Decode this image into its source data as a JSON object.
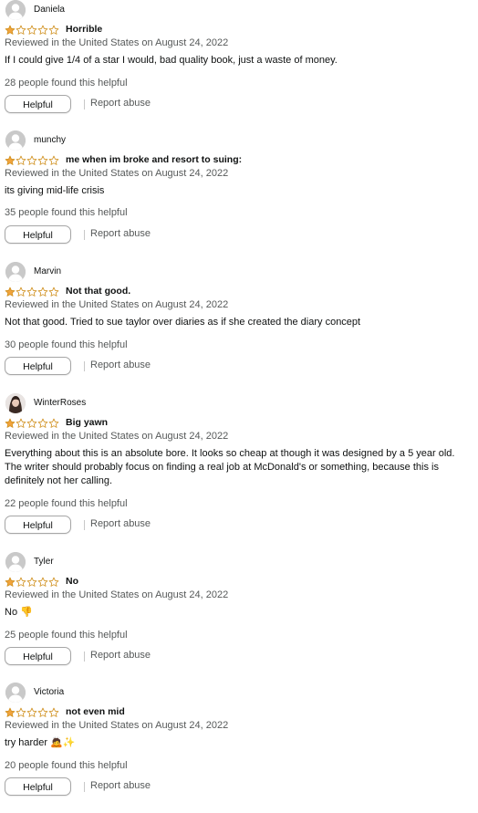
{
  "reviews": [
    {
      "user": "Daniela",
      "avatar": "default",
      "rating": 1,
      "title": "Horrible",
      "meta": "Reviewed in the United States on August 24, 2022",
      "body": "If I could give 1/4 of a star I would, bad quality book, just a waste of money.",
      "helpful_count": "28 people found this helpful",
      "helpful_label": "Helpful",
      "report_label": "Report abuse"
    },
    {
      "user": "munchy",
      "avatar": "default",
      "rating": 1,
      "title": "me when im broke and resort to suing:",
      "meta": "Reviewed in the United States on August 24, 2022",
      "body": "its giving mid-life crisis",
      "helpful_count": "35 people found this helpful",
      "helpful_label": "Helpful",
      "report_label": "Report abuse"
    },
    {
      "user": "Marvin",
      "avatar": "default",
      "rating": 1,
      "title": "Not that good.",
      "meta": "Reviewed in the United States on August 24, 2022",
      "body": "Not that good. Tried to sue taylor over diaries as if she created the diary concept",
      "helpful_count": "30 people found this helpful",
      "helpful_label": "Helpful",
      "report_label": "Report abuse"
    },
    {
      "user": "WinterRoses",
      "avatar": "photo",
      "rating": 1,
      "title": "Big yawn",
      "meta": "Reviewed in the United States on August 24, 2022",
      "body": "Everything about this is an absolute bore. It looks so cheap at though it was designed by a 5 year old. The writer should probably focus on finding a real job at McDonald's or something, because this is definitely not her calling.",
      "helpful_count": "22 people found this helpful",
      "helpful_label": "Helpful",
      "report_label": "Report abuse"
    },
    {
      "user": "Tyler",
      "avatar": "default",
      "rating": 1,
      "title": "No",
      "meta": "Reviewed in the United States on August 24, 2022",
      "body": "No 👎",
      "helpful_count": "25 people found this helpful",
      "helpful_label": "Helpful",
      "report_label": "Report abuse"
    },
    {
      "user": "Victoria",
      "avatar": "default",
      "rating": 1,
      "title": "not even mid",
      "meta": "Reviewed in the United States on August 24, 2022",
      "body": "try harder 🙇✨",
      "helpful_count": "20 people found this helpful",
      "helpful_label": "Helpful",
      "report_label": "Report abuse"
    }
  ],
  "colors": {
    "star_filled": "#f1a33c",
    "star_outline": "#d0901e",
    "text_primary": "#0f1111",
    "text_secondary": "#565959",
    "button_border": "#a6a6a6"
  }
}
